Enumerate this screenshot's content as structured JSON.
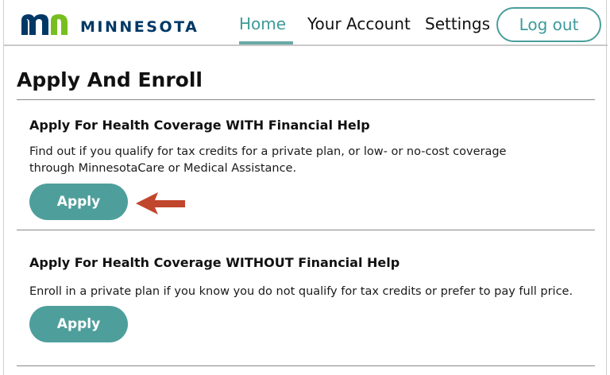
{
  "header": {
    "brand_text": "MINNESOTA",
    "nav": {
      "home": "Home",
      "account": "Your Account",
      "settings": "Settings"
    },
    "logout_label": "Log out"
  },
  "main": {
    "title": "Apply And Enroll",
    "sections": [
      {
        "heading": "Apply For Health Coverage WITH Financial Help",
        "description": "Find out if you qualify for tax credits for a private plan, or low- or no-cost coverage through MinnesotaCare or Medical Assistance.",
        "button_label": "Apply"
      },
      {
        "heading": "Apply For Health Coverage WITHOUT Financial Help",
        "description": "Enroll in a private plan if you know you do not qualify for tax credits or prefer to pay full price.",
        "button_label": "Apply"
      }
    ]
  },
  "colors": {
    "accent": "#4e9f9c",
    "brand": "#003865",
    "arrow": "#c0462d"
  },
  "icons": {
    "logo": "mn-logo-icon",
    "pointer": "arrow-left-icon"
  }
}
